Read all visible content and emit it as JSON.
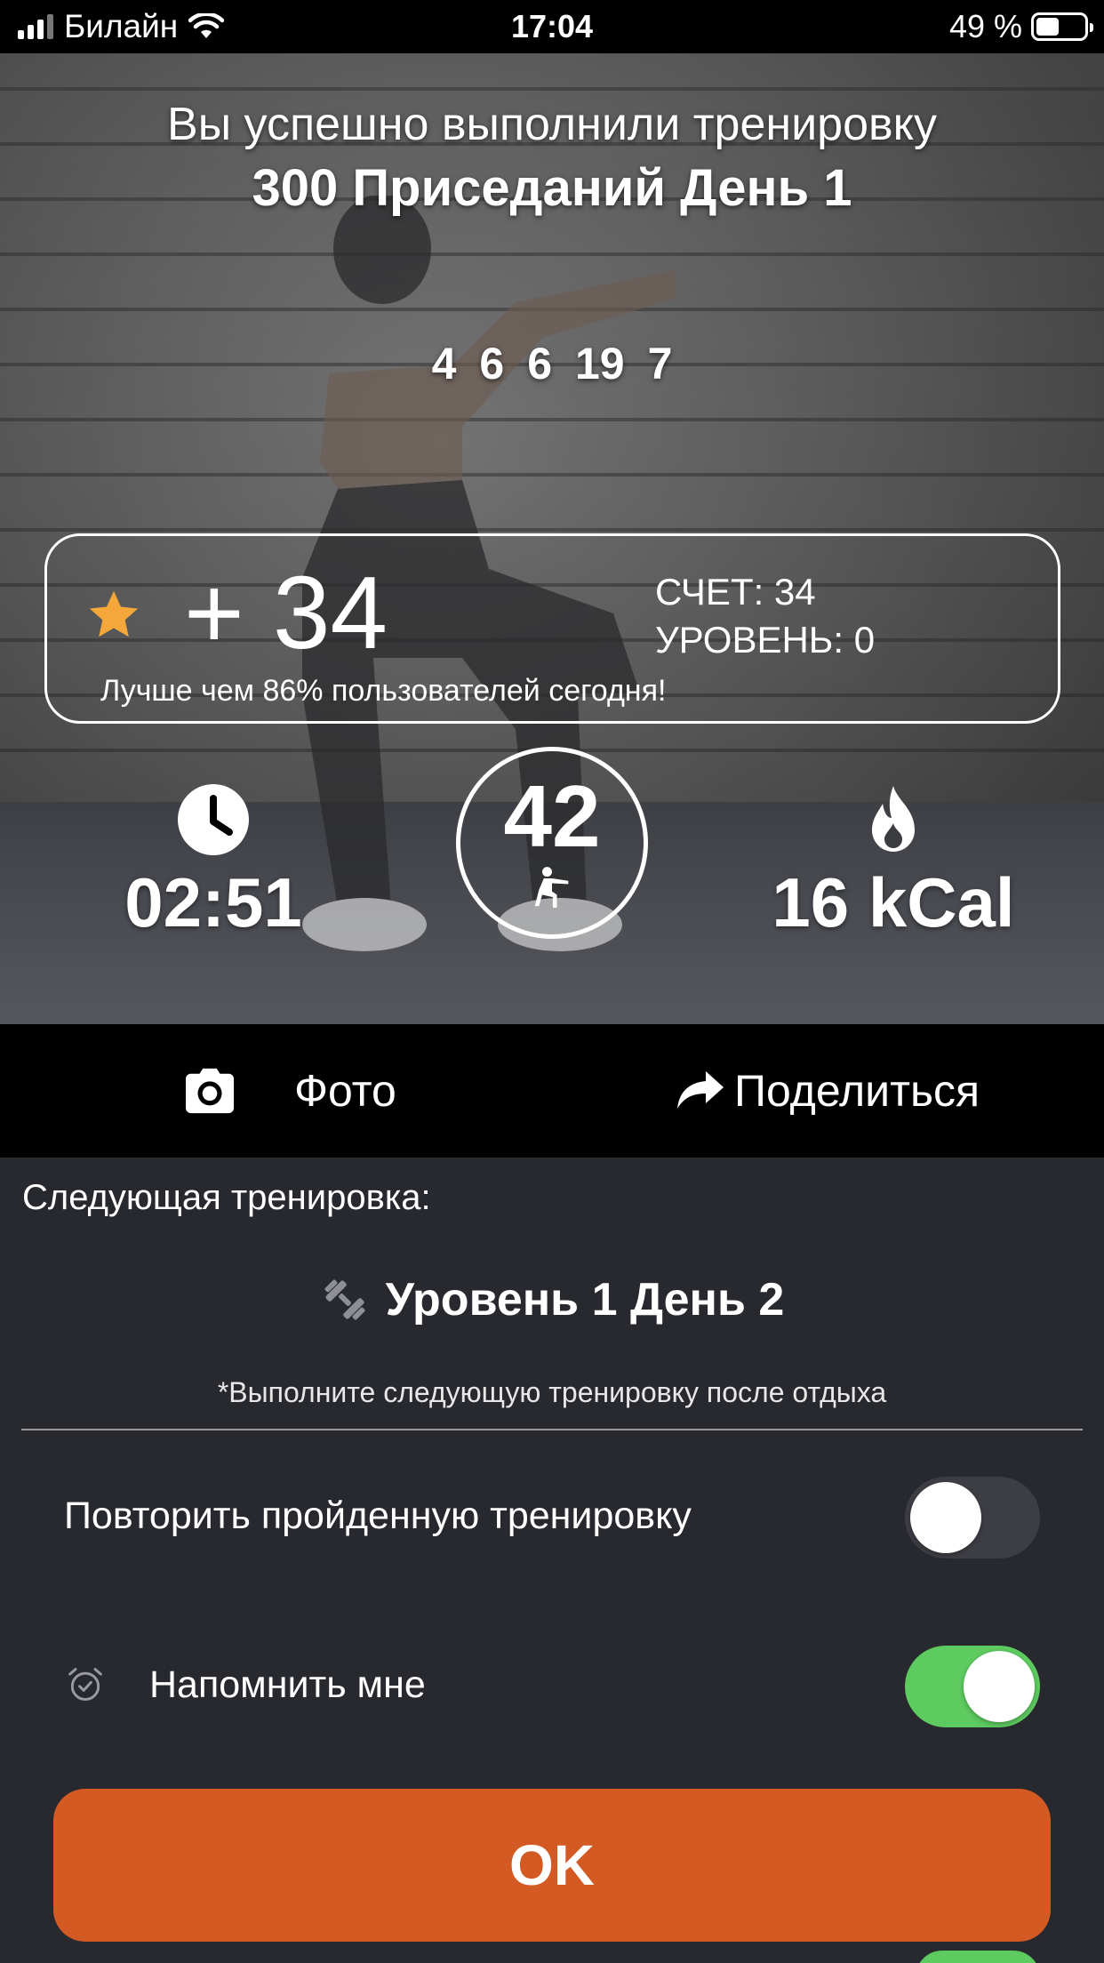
{
  "status_bar": {
    "carrier": "Билайн",
    "time": "17:04",
    "battery": "49 %",
    "battery_level": 0.49,
    "signal_bars": 3,
    "icons": [
      "signal-icon",
      "wifi-icon",
      "battery-icon"
    ]
  },
  "summary": {
    "line1": "Вы успешно выполнили тренировку",
    "line2": "300 Приседаний День 1",
    "reps": [
      "4",
      "6",
      "6",
      "19",
      "7"
    ]
  },
  "score": {
    "points": "+ 34",
    "score_label": "СЧЕТ: 34",
    "level_label": "УРОВЕНЬ: 0",
    "better_than": "Лучше чем 86% пользователей сегодня!",
    "star_color": "#f4a83a"
  },
  "stats": {
    "time": "02:51",
    "count": "42",
    "calories": "16 kCal"
  },
  "actions": {
    "photo_label": "Фото",
    "share_label": "Поделиться"
  },
  "next": {
    "label": "Следующая тренировка:",
    "title": "Уровень 1 День 2",
    "note": "*Выполните следующую тренировку после отдыха"
  },
  "settings": {
    "repeat_label": "Повторить пройденную тренировку",
    "repeat_on": false,
    "remind_label": "Напомнить мне",
    "remind_on": true
  },
  "ok_label": "OK",
  "colors": {
    "accent": "#d45a24",
    "toggle_on": "#5ecb60",
    "panel_bg": "#28292e"
  }
}
